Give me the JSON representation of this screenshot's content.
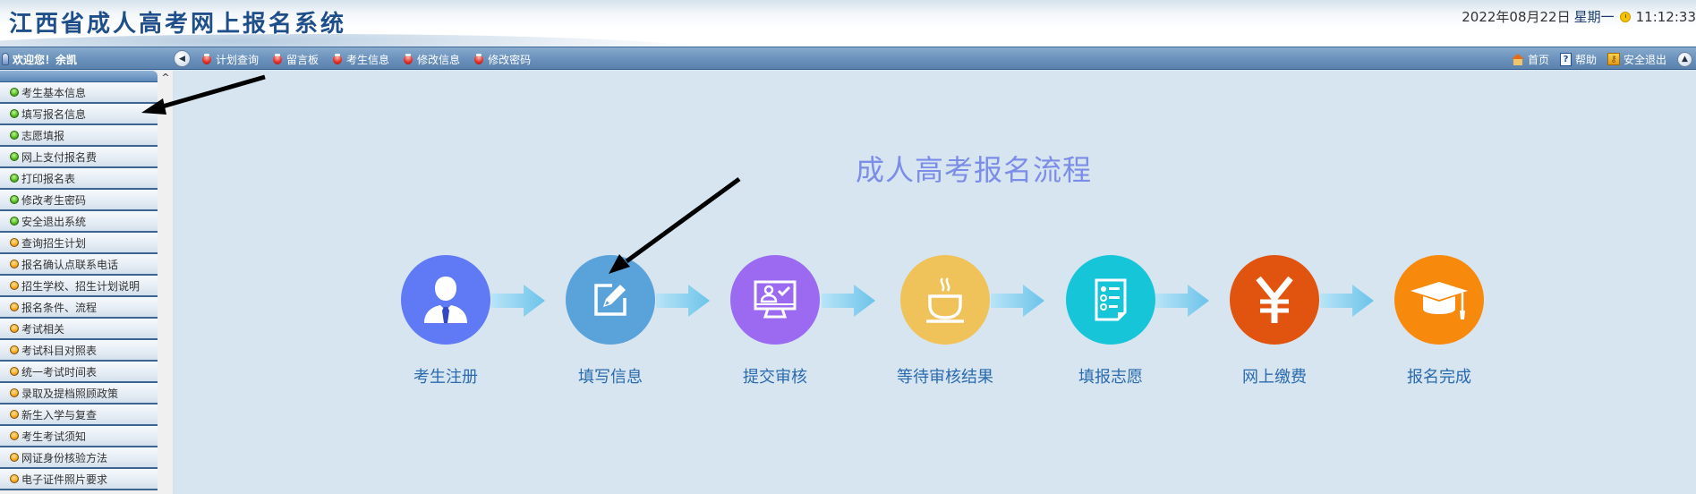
{
  "header": {
    "site_title": "江西省成人高考网上报名系统",
    "date": "2022年08月22日",
    "weekday": "星期一",
    "time": "11:12:33"
  },
  "navbar": {
    "welcome": "欢迎您！余凯",
    "links": [
      {
        "label": "计划查询",
        "icon": "red-dot-icon"
      },
      {
        "label": "留言板",
        "icon": "red-dot-icon"
      },
      {
        "label": "考生信息",
        "icon": "red-dot-icon"
      },
      {
        "label": "修改信息",
        "icon": "red-dot-icon"
      },
      {
        "label": "修改密码",
        "icon": "red-dot-icon"
      }
    ],
    "right_links": [
      {
        "label": "首页",
        "icon": "home-icon"
      },
      {
        "label": "帮助",
        "icon": "help-icon"
      },
      {
        "label": "安全退出",
        "icon": "key-icon"
      }
    ]
  },
  "sidebar": {
    "items": [
      {
        "label": "考生基本信息",
        "status": "green"
      },
      {
        "label": "填写报名信息",
        "status": "green"
      },
      {
        "label": "志愿填报",
        "status": "green"
      },
      {
        "label": "网上支付报名费",
        "status": "green"
      },
      {
        "label": "打印报名表",
        "status": "green"
      },
      {
        "label": "修改考生密码",
        "status": "green"
      },
      {
        "label": "安全退出系统",
        "status": "green"
      },
      {
        "label": "查询招生计划",
        "status": "orange"
      },
      {
        "label": "报名确认点联系电话",
        "status": "orange"
      },
      {
        "label": "招生学校、招生计划说明",
        "status": "orange"
      },
      {
        "label": "报名条件、流程",
        "status": "orange"
      },
      {
        "label": "考试相关",
        "status": "orange"
      },
      {
        "label": "考试科目对照表",
        "status": "orange"
      },
      {
        "label": "统一考试时间表",
        "status": "orange"
      },
      {
        "label": "录取及提档照顾政策",
        "status": "orange"
      },
      {
        "label": "新生入学与复查",
        "status": "orange"
      },
      {
        "label": "考生考试须知",
        "status": "orange"
      },
      {
        "label": "网证身份核验方法",
        "status": "orange"
      },
      {
        "label": "电子证件照片要求",
        "status": "orange"
      }
    ]
  },
  "main": {
    "flow_title": "成人高考报名流程",
    "steps": [
      {
        "label": "考生注册",
        "icon": "user-tie-icon",
        "color": "#6079f5"
      },
      {
        "label": "填写信息",
        "icon": "edit-icon",
        "color": "#5aa2da"
      },
      {
        "label": "提交审核",
        "icon": "monitor-check-icon",
        "color": "#9b6af0"
      },
      {
        "label": "等待审核结果",
        "icon": "coffee-cup-icon",
        "color": "#f0c25a"
      },
      {
        "label": "填报志愿",
        "icon": "checklist-icon",
        "color": "#17c5d8"
      },
      {
        "label": "网上缴费",
        "icon": "yen-icon",
        "color": "#e0540f"
      },
      {
        "label": "报名完成",
        "icon": "graduation-cap-icon",
        "color": "#f7890c"
      }
    ]
  }
}
